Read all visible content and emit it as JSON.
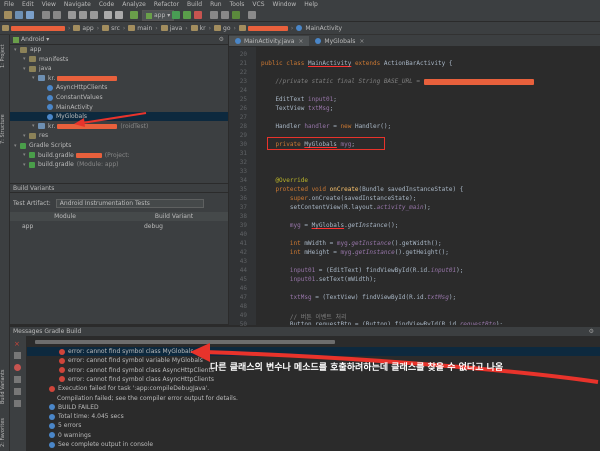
{
  "menu": [
    "File",
    "Edit",
    "View",
    "Navigate",
    "Code",
    "Analyze",
    "Refactor",
    "Build",
    "Run",
    "Tools",
    "VCS",
    "Window",
    "Help"
  ],
  "toolbar": {
    "run_config": "app"
  },
  "breadcrumb": [
    "app",
    "src",
    "main",
    "java",
    "kr",
    "go",
    "MainActivity"
  ],
  "project": {
    "selector": "Android",
    "tree": [
      {
        "label": "app",
        "depth": 0,
        "icon": "folder"
      },
      {
        "label": "manifests",
        "depth": 1,
        "icon": "folder"
      },
      {
        "label": "java",
        "depth": 1,
        "icon": "folder"
      },
      {
        "label": "kr.",
        "depth": 2,
        "icon": "package"
      },
      {
        "label": "AsyncHttpClients",
        "depth": 3,
        "icon": "class"
      },
      {
        "label": "ConstantValues",
        "depth": 3,
        "icon": "class"
      },
      {
        "label": "MainActivity",
        "depth": 3,
        "icon": "class"
      },
      {
        "label": "MyGlobals",
        "depth": 3,
        "icon": "class"
      },
      {
        "label": "kr.",
        "suffix": "(roidTest)",
        "depth": 2,
        "icon": "package"
      },
      {
        "label": "res",
        "depth": 1,
        "icon": "folder"
      },
      {
        "label": "Gradle Scripts",
        "depth": 0,
        "icon": "gradle"
      },
      {
        "label": "build.gradle",
        "suffix": "(Project:",
        "depth": 1,
        "icon": "gradle"
      },
      {
        "label": "build.gradle",
        "suffix": "(Module: app)",
        "depth": 1,
        "icon": "gradle"
      }
    ]
  },
  "build_variants": {
    "title": "Build Variants",
    "test_artifact_label": "Test Artifact:",
    "test_artifact_value": "Android Instrumentation Tests",
    "col_module": "Module",
    "col_variant": "Build Variant",
    "row_module": "app",
    "row_variant": "debug"
  },
  "side_tabs": {
    "project": "1: Project",
    "structure": "7: Structure",
    "build_variants": "Build Variants",
    "favorites": "2: Favorites"
  },
  "editor": {
    "tabs": [
      "MainActivity.java",
      "MyGlobals"
    ],
    "line_numbers": [
      "20",
      "21",
      "22",
      "23",
      "24",
      "25",
      "26",
      "27",
      "28",
      "29",
      "30",
      "31",
      "32",
      "33",
      "34",
      "35",
      "36",
      "37",
      "38",
      "39",
      "40",
      "41",
      "42",
      "43",
      "44",
      "45",
      "46",
      "47",
      "48",
      "49",
      "50"
    ]
  },
  "messages": {
    "header": "Messages Gradle Build",
    "rows": [
      {
        "type": "error",
        "text": "error: cannot find symbol class MyGlobals",
        "selected": true
      },
      {
        "type": "error",
        "text": "error: cannot find symbol variable MyGlobals"
      },
      {
        "type": "error",
        "text": "error: cannot find symbol class AsyncHttpClients"
      },
      {
        "type": "error",
        "text": "error: cannot find symbol class AsyncHttpClients"
      },
      {
        "type": "error",
        "text": "Execution failed for task ':app:compileDebugJava'."
      },
      {
        "type": "info",
        "text": "Compilation failed; see the compiler error output for details."
      },
      {
        "type": "info",
        "text": "BUILD FAILED"
      },
      {
        "type": "info",
        "text": "Total time: 4.045 secs"
      },
      {
        "type": "info",
        "text": "5 errors"
      },
      {
        "type": "info",
        "text": "0 warnings"
      },
      {
        "type": "info",
        "text": "See complete output in console"
      }
    ]
  },
  "annotation": {
    "text": "다른 클래스의 변수나 메소드를 호출하려하는데 클래스를 찾을 수 없다고 나옴",
    "color": "#e8332b"
  },
  "colors": {
    "keyword": "#cc7832",
    "method": "#ffc66d",
    "field": "#9876aa",
    "comment": "#808080",
    "redact": "#e8603c",
    "highlight_box": "#e8332b"
  }
}
